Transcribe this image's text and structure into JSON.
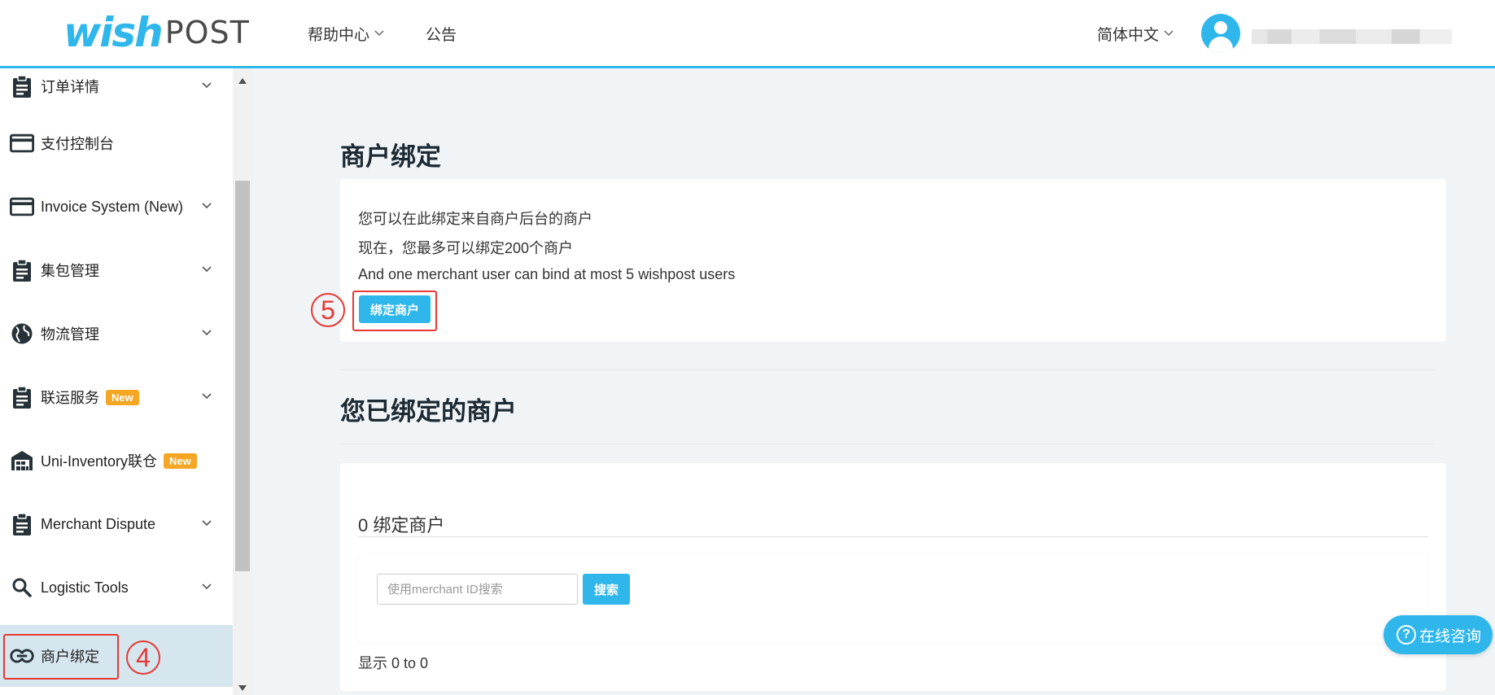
{
  "header": {
    "logo_wish": "wish",
    "logo_post": "POST",
    "nav_help": "帮助中心",
    "nav_announcement": "公告",
    "language": "简体中文"
  },
  "sidebar": {
    "items": [
      {
        "label": "订单详情",
        "icon": "clipboard-icon",
        "has_chevron": true
      },
      {
        "label": "支付控制台",
        "icon": "credit-card-icon",
        "has_chevron": false
      },
      {
        "label": "Invoice System (New)",
        "icon": "credit-card-icon",
        "has_chevron": true
      },
      {
        "label": "集包管理",
        "icon": "clipboard-icon",
        "has_chevron": true
      },
      {
        "label": "物流管理",
        "icon": "globe-icon",
        "has_chevron": true
      },
      {
        "label": "联运服务",
        "icon": "clipboard-icon",
        "has_chevron": true,
        "badge": "New"
      },
      {
        "label": "Uni-Inventory联仓",
        "icon": "warehouse-icon",
        "has_chevron": false,
        "badge": "New"
      },
      {
        "label": "Merchant Dispute",
        "icon": "clipboard-icon",
        "has_chevron": true
      },
      {
        "label": "Logistic Tools",
        "icon": "search-icon",
        "has_chevron": true
      },
      {
        "label": "商户绑定",
        "icon": "link-icon",
        "has_chevron": false,
        "active": true
      }
    ]
  },
  "main": {
    "section1_title": "商户绑定",
    "info_lines": [
      "您可以在此绑定来自商户后台的商户",
      "现在，您最多可以绑定200个商户",
      "And one merchant user can bind at most 5 wishpost users"
    ],
    "bind_button": "绑定商户",
    "section2_title": "您已绑定的商户",
    "bound_count_label": "0 绑定商户",
    "search_placeholder": "使用merchant ID搜索",
    "search_button": "搜索",
    "showing": "显示 0 to 0"
  },
  "annotations": {
    "marker_4": "4",
    "marker_5": "5"
  },
  "chat": {
    "label": "在线咨询"
  },
  "colors": {
    "accent": "#2fb7ec",
    "annotation": "#e53935",
    "badge": "#f5a623",
    "active_bg": "#d6e6ef"
  }
}
